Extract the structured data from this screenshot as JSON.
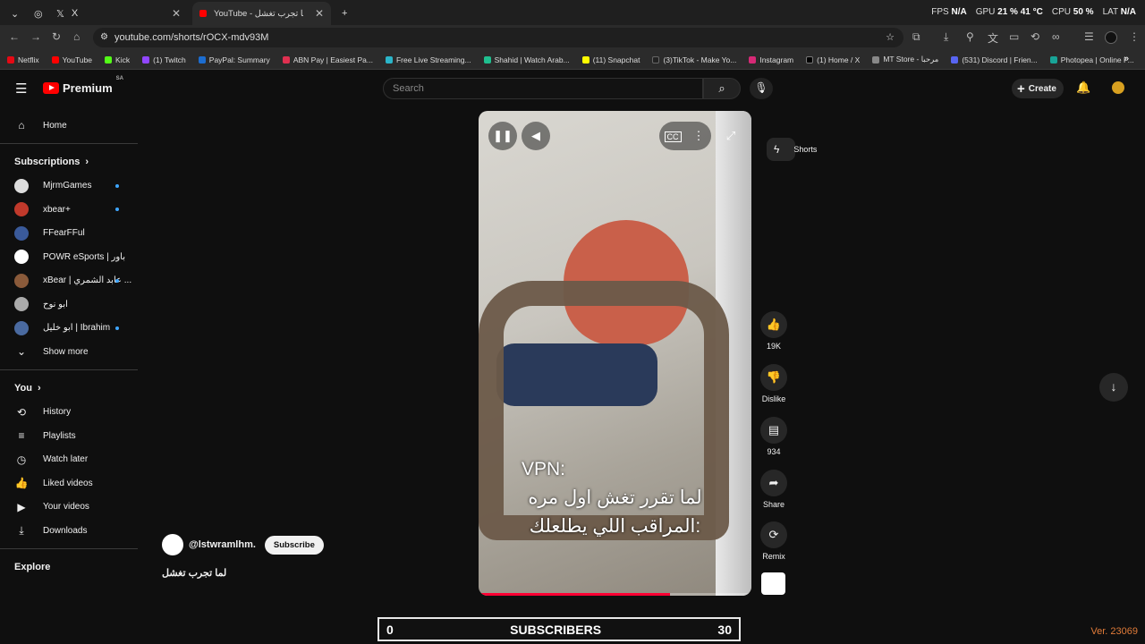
{
  "browser": {
    "tabs": [
      {
        "title": "X",
        "close": "✕"
      },
      {
        "title": "YouTube - لما تجرب تغشل",
        "close": "✕"
      }
    ],
    "new_tab": "+",
    "url": "youtube.com/shorts/rOCX-mdv93M",
    "perf": {
      "fps_label": "FPS",
      "fps": "N/A",
      "gpu_label": "GPU",
      "gpu": "21 %  41 °C",
      "cpu_label": "CPU",
      "cpu": "50 %",
      "lat_label": "LAT",
      "lat": "N/A"
    }
  },
  "bookmarks": [
    {
      "label": "Netflix",
      "color": "#e50914"
    },
    {
      "label": "YouTube",
      "color": "#ff0000"
    },
    {
      "label": "Kick",
      "color": "#53fc18"
    },
    {
      "label": "(1) Twitch",
      "color": "#9146ff"
    },
    {
      "label": "PayPal: Summary",
      "color": "#1c6dd0"
    },
    {
      "label": "ABN Pay | Easiest Pa...",
      "color": "#e03050"
    },
    {
      "label": "Free Live Streaming...",
      "color": "#2bb5c9"
    },
    {
      "label": "Shahid | Watch Arab...",
      "color": "#1fbf8f"
    },
    {
      "label": "(11) Snapchat",
      "color": "#fffc00"
    },
    {
      "label": "(3)TikTok - Make Yo...",
      "color": "#222"
    },
    {
      "label": "Instagram",
      "color": "#d62976"
    },
    {
      "label": "(1) Home / X",
      "color": "#000"
    },
    {
      "label": "MT Store - مرحبا",
      "color": "#888"
    },
    {
      "label": "(531) Discord | Frien...",
      "color": "#5865f2"
    },
    {
      "label": "Photopea | Online P...",
      "color": "#18a497"
    }
  ],
  "yt": {
    "logo_text": "Premium",
    "region": "SA",
    "search_placeholder": "Search",
    "create_label": "Create"
  },
  "sidebar": {
    "home": "Home",
    "shorts": "Shorts",
    "subscriptions_label": "Subscriptions",
    "subs": [
      {
        "name": "MjrmGames",
        "color": "#ddd",
        "dot": true
      },
      {
        "name": "xbear+",
        "color": "#c0392b",
        "dot": true
      },
      {
        "name": "FFearFFul",
        "color": "#3a5a9a",
        "dot": false
      },
      {
        "name": "POWR eSports | باور",
        "color": "#fff",
        "dot": false
      },
      {
        "name": "xBear | عابد الشمري ...",
        "color": "#8a5a3a",
        "dot": true
      },
      {
        "name": "ابو نوح",
        "color": "#aaa",
        "dot": false
      },
      {
        "name": "ابو خليل | Ibrahim",
        "color": "#4a6aa0",
        "dot": true
      }
    ],
    "show_more": "Show more",
    "you_label": "You",
    "you_items": [
      "History",
      "Playlists",
      "Watch later",
      "Liked videos",
      "Your videos",
      "Downloads"
    ],
    "explore_label": "Explore"
  },
  "video": {
    "caption_line1": "VPN:",
    "caption_line2": "لما تقرر تغش اول مره",
    "caption_line3": "المراقب اللي يطلعلك:",
    "progress": 0.7
  },
  "actions": {
    "likes": "19K",
    "dislike": "Dislike",
    "comments": "934",
    "share": "Share",
    "remix": "Remix"
  },
  "channel": {
    "handle": "@lstwramlhm.",
    "subscribe": "Subscribe",
    "title": "لما تجرب تغشل"
  },
  "overlay": {
    "left": "0",
    "label": "SUBSCRIBERS",
    "right": "30",
    "version": "Ver. 23069"
  }
}
